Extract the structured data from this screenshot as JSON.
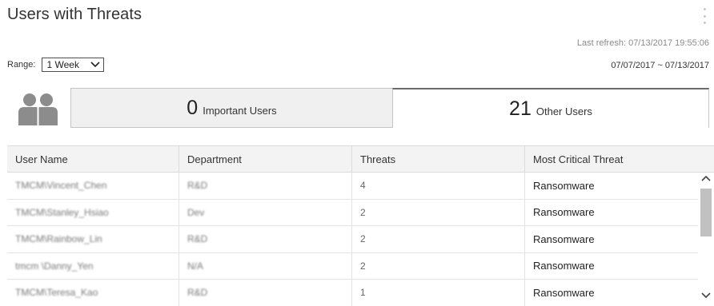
{
  "widget": {
    "title": "Users with Threats",
    "last_refresh": "Last refresh:  07/13/2017 19:55:06",
    "range_label": "Range:",
    "range_value": "1 Week",
    "date_range": "07/07/2017  ~  07/13/2017"
  },
  "tabs": [
    {
      "count": "0",
      "label": "Important Users",
      "selected": false
    },
    {
      "count": "21",
      "label": "Other Users",
      "selected": true
    }
  ],
  "table": {
    "columns": [
      "User Name",
      "Department",
      "Threats",
      "Most Critical Threat"
    ],
    "rows": [
      {
        "user": "TMCM\\Vincent_Chen",
        "department": "R&D",
        "threats": "4",
        "critical": "Ransomware"
      },
      {
        "user": "TMCM\\Stanley_Hsiao",
        "department": "Dev",
        "threats": "2",
        "critical": "Ransomware"
      },
      {
        "user": "TMCM\\Rainbow_Lin",
        "department": "R&D",
        "threats": "2",
        "critical": "Ransomware"
      },
      {
        "user": "tmcm \\Danny_Yen",
        "department": "N/A",
        "threats": "2",
        "critical": "Ransomware"
      },
      {
        "user": "TMCM\\Teresa_Kao",
        "department": "R&D",
        "threats": "1",
        "critical": "Ransomware"
      }
    ]
  },
  "icons": {
    "users": "users-icon",
    "menu": "more-vertical-icon",
    "dropdown": "chevron-down-icon",
    "scroll_up": "chevron-up-icon",
    "scroll_down": "chevron-down-icon"
  },
  "colors": {
    "icon_gray": "#8c8c8c",
    "tab_selected_border": "#6b6b6b",
    "header_bg": "#f3f3f3"
  }
}
